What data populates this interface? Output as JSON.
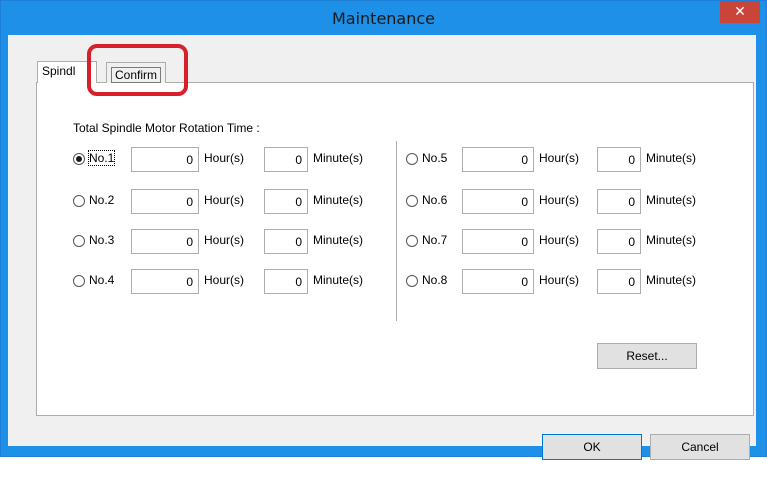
{
  "window": {
    "title": "Maintenance",
    "close_glyph": "✕"
  },
  "tabs": [
    {
      "label": "Spindl",
      "selected": true
    },
    {
      "label": "Confirm",
      "selected": false
    }
  ],
  "section_label": "Total Spindle Motor Rotation Time :",
  "spindles": [
    {
      "label": "No.1",
      "selected": true,
      "hours": "0",
      "minutes": "0"
    },
    {
      "label": "No.2",
      "selected": false,
      "hours": "0",
      "minutes": "0"
    },
    {
      "label": "No.3",
      "selected": false,
      "hours": "0",
      "minutes": "0"
    },
    {
      "label": "No.4",
      "selected": false,
      "hours": "0",
      "minutes": "0"
    },
    {
      "label": "No.5",
      "selected": false,
      "hours": "0",
      "minutes": "0"
    },
    {
      "label": "No.6",
      "selected": false,
      "hours": "0",
      "minutes": "0"
    },
    {
      "label": "No.7",
      "selected": false,
      "hours": "0",
      "minutes": "0"
    },
    {
      "label": "No.8",
      "selected": false,
      "hours": "0",
      "minutes": "0"
    }
  ],
  "units": {
    "hours": "Hour(s)",
    "minutes": "Minute(s)"
  },
  "buttons": {
    "reset": "Reset...",
    "ok": "OK",
    "cancel": "Cancel"
  },
  "colors": {
    "titlebar": "#1e90e8",
    "close_button": "#c9453a",
    "highlight": "#d8202a"
  }
}
